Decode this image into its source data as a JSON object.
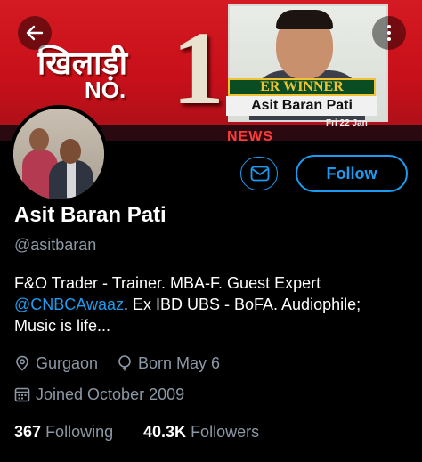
{
  "banner": {
    "hindi_text": "खिलाड़ी",
    "no_text": "NO.",
    "number": "1",
    "winner_text": "ER WINNER",
    "caption_name": "Asit Baran Pati",
    "date_text": "Fri 22 Jan",
    "news_text": "NEWS"
  },
  "icons": {
    "back": "arrow-left-icon",
    "more": "more-vertical-icon",
    "message": "mail-icon",
    "location": "location-icon",
    "birthday": "balloon-icon",
    "calendar": "calendar-icon"
  },
  "profile": {
    "display_name": "Asit Baran Pati",
    "handle": "@asitbaran",
    "follow_label": "Follow",
    "bio_part1": "F&O Trader - Trainer. MBA-F. Guest Expert ",
    "bio_mention": "@CNBCAwaaz",
    "bio_part2": ". Ex IBD UBS - BoFA. Audiophile; Music is life...",
    "location": "Gurgaon",
    "birthday": "Born May 6",
    "joined": "Joined October 2009",
    "following_count": "367",
    "following_label": "Following",
    "followers_count": "40.3K",
    "followers_label": "Followers"
  },
  "colors": {
    "accent": "#1d9bf0",
    "secondary_text": "#8b98a5",
    "background": "#000000"
  }
}
